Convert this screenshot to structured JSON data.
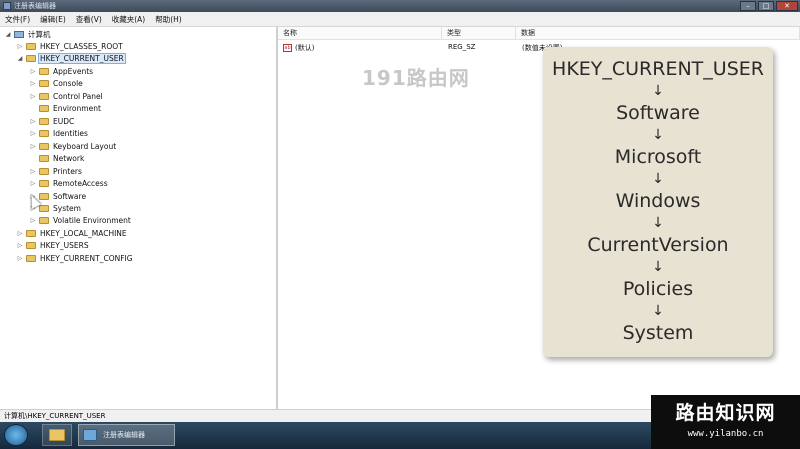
{
  "window": {
    "title": "注册表编辑器",
    "minimize": "–",
    "maximize": "□",
    "close": "✕"
  },
  "menu": [
    "文件(F)",
    "编辑(E)",
    "查看(V)",
    "收藏夹(A)",
    "帮助(H)"
  ],
  "tree": {
    "root": "计算机",
    "hives": [
      {
        "label": "HKEY_CLASSES_ROOT",
        "toggle": "▷"
      },
      {
        "label": "HKEY_CURRENT_USER",
        "toggle": "◢"
      },
      {
        "label": "HKEY_LOCAL_MACHINE",
        "toggle": "▷"
      },
      {
        "label": "HKEY_USERS",
        "toggle": "▷"
      },
      {
        "label": "HKEY_CURRENT_CONFIG",
        "toggle": "▷"
      }
    ],
    "children": [
      "AppEvents",
      "Console",
      "Control Panel",
      "Environment",
      "EUDC",
      "Identities",
      "Keyboard Layout",
      "Network",
      "Printers",
      "RemoteAccess",
      "Software",
      "System",
      "Volatile Environment"
    ]
  },
  "list": {
    "headers": [
      "名称",
      "类型",
      "数据"
    ],
    "rows": [
      {
        "name": "(默认)",
        "type": "REG_SZ",
        "data": "(数值未设置)",
        "icon_text": "ab"
      }
    ]
  },
  "watermark_top": "191路由网",
  "path_steps": [
    "HKEY_CURRENT_USER",
    "Software",
    "Microsoft",
    "Windows",
    "CurrentVersion",
    "Policies",
    "System"
  ],
  "arrow": "↓",
  "status": "计算机\\HKEY_CURRENT_USER",
  "taskbar": {
    "regedit_label": "注册表编辑器"
  },
  "watermark_bottom": {
    "title": "路由知识网",
    "url": "www.yilanbo.cn"
  }
}
